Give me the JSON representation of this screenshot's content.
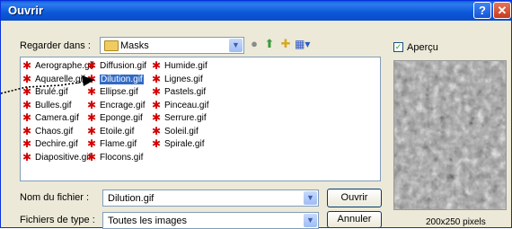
{
  "window": {
    "title": "Ouvrir"
  },
  "lookin": {
    "label": "Regarder dans :",
    "value": "Masks"
  },
  "files": [
    [
      "Aerographe.gif",
      "Aquarelle.gif",
      "Brulé.gif",
      "Bulles.gif",
      "Camera.gif",
      "Chaos.gif",
      "Dechire.gif",
      "Diapositive.gif"
    ],
    [
      "Diffusion.gif",
      "Dilution.gif",
      "Ellipse.gif",
      "Encrage.gif",
      "Eponge.gif",
      "Etoile.gif",
      "Flame.gif",
      "Flocons.gif"
    ],
    [
      "Humide.gif",
      "Lignes.gif",
      "Pastels.gif",
      "Pinceau.gif",
      "Serrure.gif",
      "Soleil.gif",
      "Spirale.gif"
    ]
  ],
  "selected_file": "Dilution.gif",
  "filename": {
    "label": "Nom du fichier :",
    "value": "Dilution.gif"
  },
  "filetype": {
    "label": "Fichiers de type :",
    "value": "Toutes les images"
  },
  "buttons": {
    "open": "Ouvrir",
    "cancel": "Annuler"
  },
  "preview": {
    "checkbox_label": "Aperçu",
    "checked": true,
    "dimensions": "200x250 pixels"
  }
}
